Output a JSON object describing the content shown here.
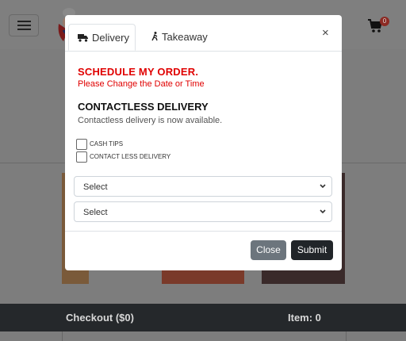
{
  "header": {
    "cart_count": "0",
    "icons": {
      "menu": "hamburger-menu-icon",
      "logo": "chef-logo",
      "cart": "cart-icon"
    }
  },
  "modal": {
    "tabs": [
      {
        "label": "Delivery",
        "icon": "truck-icon",
        "active": true
      },
      {
        "label": "Takeaway",
        "icon": "walking-icon",
        "active": false
      }
    ],
    "close_symbol": "×",
    "schedule": {
      "title": "SCHEDULE MY ORDER.",
      "subtitle": "Please Change the Date or Time"
    },
    "contactless": {
      "title": "CONTACTLESS DELIVERY",
      "subtitle": "Contactless delivery is now available."
    },
    "checkboxes": [
      {
        "label": "CASH TIPS",
        "checked": false
      },
      {
        "label": "CONTACT LESS DELIVERY",
        "checked": false
      }
    ],
    "selects": [
      {
        "value": "Select"
      },
      {
        "value": "Select"
      }
    ],
    "buttons": {
      "close": "Close",
      "submit": "Submit"
    }
  },
  "checkout_bar": {
    "checkout": "Checkout ($0)",
    "items": "Item: 0"
  },
  "colors": {
    "accent_red": "#e00000",
    "bar_dark": "#25282b",
    "overlay": "#7d7d7d"
  }
}
